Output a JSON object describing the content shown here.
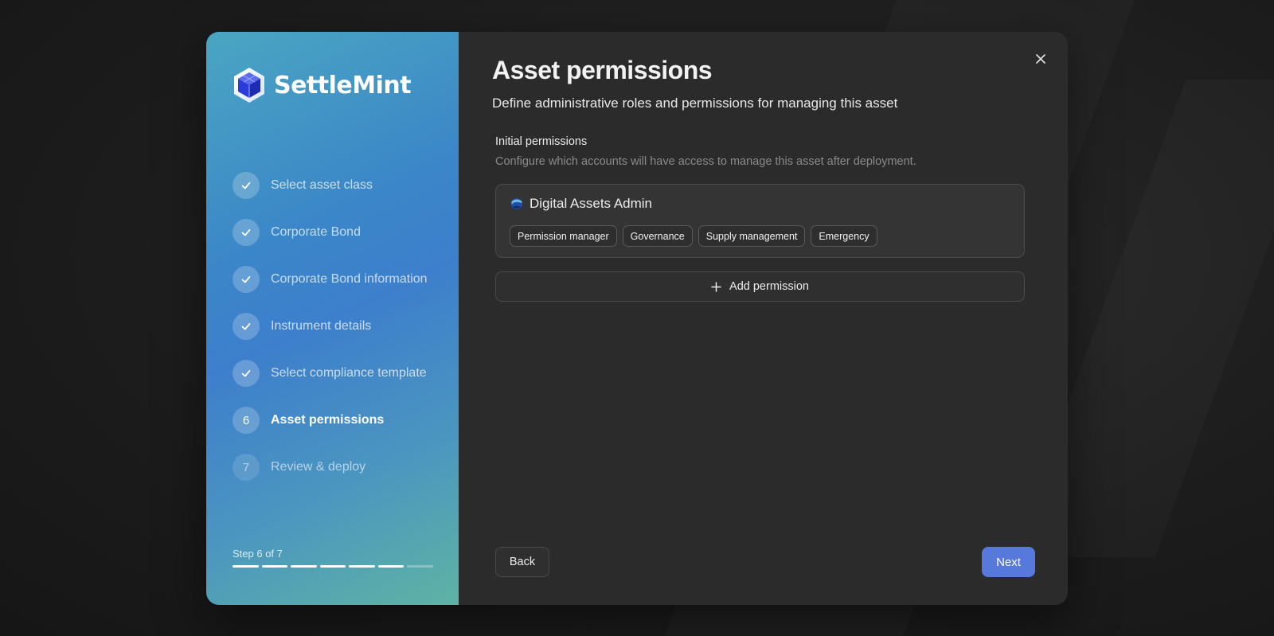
{
  "brand": {
    "name": "SettleMint"
  },
  "steps": [
    {
      "label": "Select asset class",
      "status": "done",
      "icon": "check-icon"
    },
    {
      "label": "Corporate Bond",
      "status": "done",
      "icon": "check-icon"
    },
    {
      "label": "Corporate Bond information",
      "status": "done",
      "icon": "check-icon"
    },
    {
      "label": "Instrument details",
      "status": "done",
      "icon": "check-icon"
    },
    {
      "label": "Select compliance template",
      "status": "done",
      "icon": "check-icon"
    },
    {
      "label": "Asset permissions",
      "status": "current",
      "number": "6"
    },
    {
      "label": "Review & deploy",
      "status": "future",
      "number": "7"
    }
  ],
  "progress": {
    "text": "Step 6 of 7",
    "current": 6,
    "total": 7
  },
  "main": {
    "title": "Asset permissions",
    "subtitle": "Define administrative roles and permissions for managing this asset",
    "section_title": "Initial permissions",
    "section_description": "Configure which accounts will have access to manage this asset after deployment.",
    "permission": {
      "account": "Digital Assets Admin",
      "roles": [
        "Permission manager",
        "Governance",
        "Supply management",
        "Emergency"
      ]
    },
    "add_label": "Add permission"
  },
  "footer": {
    "back_label": "Back",
    "next_label": "Next"
  },
  "colors": {
    "accent": "#5879dc",
    "panel_bg": "#2b2b2b"
  }
}
